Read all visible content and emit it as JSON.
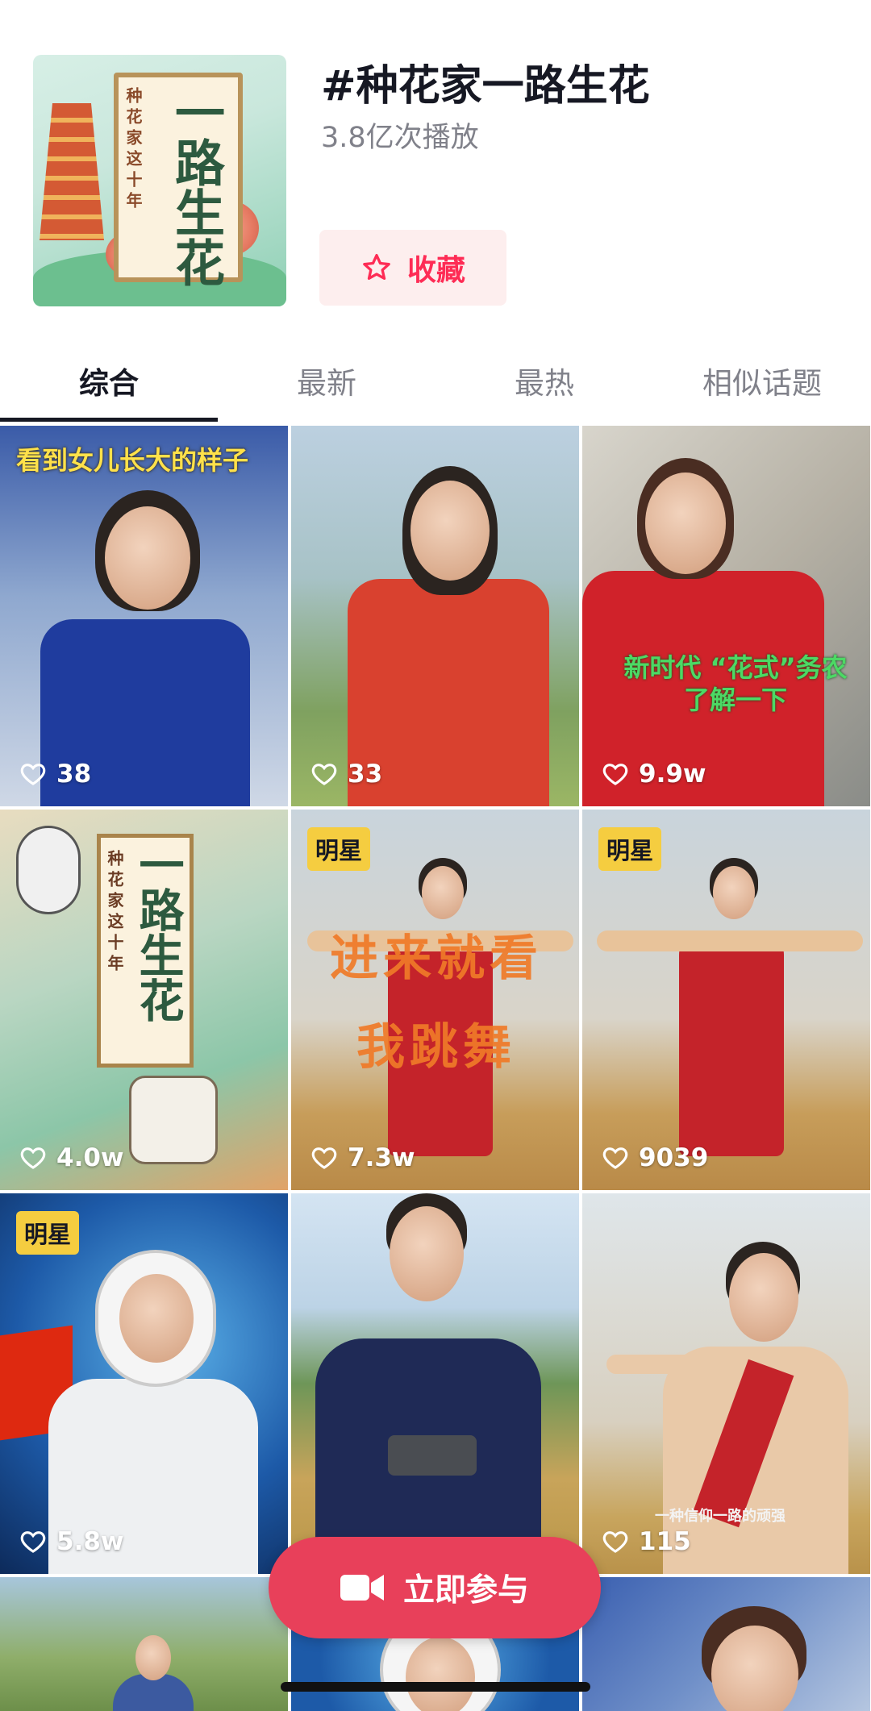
{
  "topic": {
    "title": "#种花家一路生花",
    "play_count": "3.8亿次播放",
    "favorite_label": "收藏",
    "cover_small_text": "种花家这十年",
    "cover_big_text": "一路生花"
  },
  "tabs": [
    {
      "label": "综合",
      "active": true
    },
    {
      "label": "最新",
      "active": false
    },
    {
      "label": "最热",
      "active": false
    },
    {
      "label": "相似话题",
      "active": false
    }
  ],
  "videos": [
    {
      "likes": "38",
      "overlay": "看到女儿长大的样子",
      "badge": ""
    },
    {
      "likes": "33",
      "overlay": "",
      "badge": ""
    },
    {
      "likes": "9.9w",
      "overlay": "新时代 “花式”务农 了解一下",
      "badge": ""
    },
    {
      "likes": "4.0w",
      "overlay": "",
      "badge": "",
      "cover_small_text": "种花家这十年",
      "cover_big_text": "一路生花"
    },
    {
      "likes": "7.3w",
      "overlay": "进来就看 我跳舞",
      "badge": "明星"
    },
    {
      "likes": "9039",
      "overlay": "",
      "badge": "明星"
    },
    {
      "likes": "5.8w",
      "overlay": "",
      "badge": "明星"
    },
    {
      "likes": "",
      "overlay": "",
      "badge": ""
    },
    {
      "likes": "115",
      "overlay": "一种信仰一路的顽强",
      "badge": ""
    }
  ],
  "join_button": {
    "label": "立即参与"
  },
  "colors": {
    "accent": "#fe2c55",
    "join_bg": "#e8405a",
    "badge_bg": "#f5cd40"
  },
  "icons": {
    "favorite": "star-outline-icon",
    "like": "heart-outline-icon",
    "join": "video-camera-icon"
  }
}
